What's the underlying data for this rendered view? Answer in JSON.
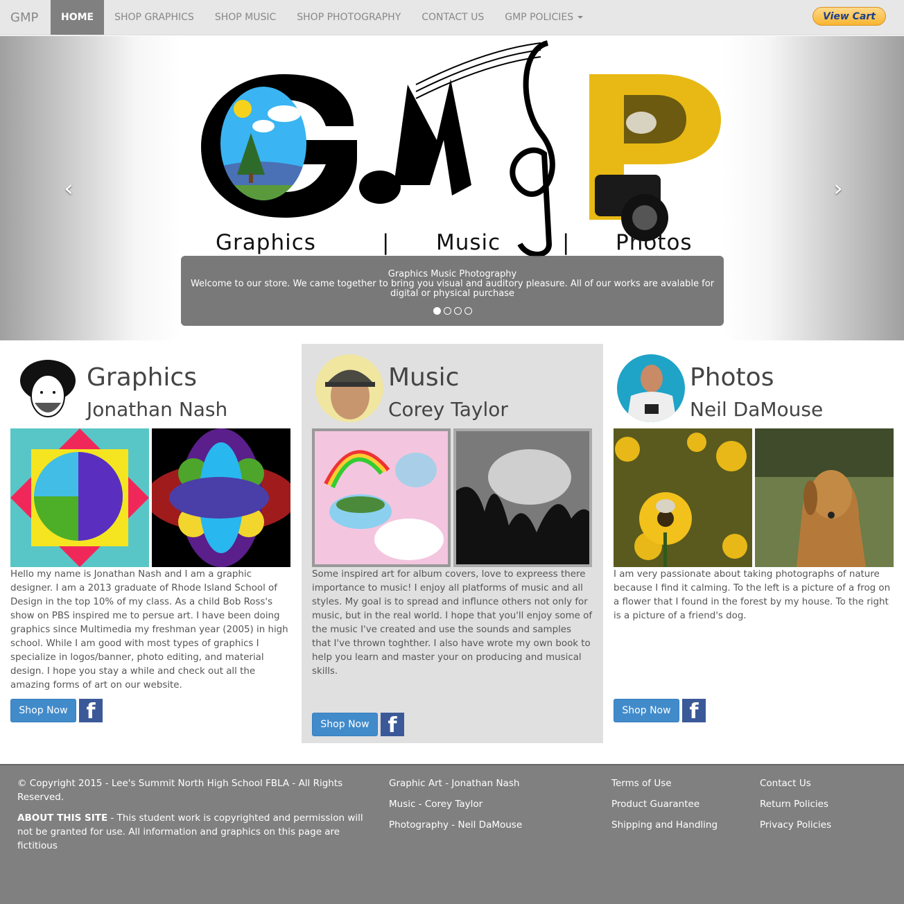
{
  "navbar": {
    "brand": "GMP",
    "items": [
      {
        "label": "HOME",
        "active": true
      },
      {
        "label": "SHOP GRAPHICS"
      },
      {
        "label": "SHOP MUSIC"
      },
      {
        "label": "SHOP PHOTOGRAPHY"
      },
      {
        "label": "CONTACT US"
      },
      {
        "label": "GMP POLICIES"
      }
    ],
    "cart_label": "View Cart"
  },
  "carousel": {
    "logo_letters": [
      "G",
      "M",
      "P"
    ],
    "tagline": [
      "Graphics",
      "|",
      "Music",
      "|",
      "Photos"
    ],
    "caption_title": "Graphics Music Photography",
    "caption_text": "Welcome to our store. We came together to bring you visual and auditory pleasure. All of our works are avalable for digital or physical purchase",
    "slide_count": 4,
    "active_slide": 1,
    "prev_icon": "chevron-left-icon",
    "next_icon": "chevron-right-icon"
  },
  "columns": [
    {
      "title": "Graphics",
      "name": "Jonathan Nash",
      "bio": "Hello my name is Jonathan Nash and I am a graphic designer. I am a 2013 graduate of Rhode Island School of Design in the top 10% of my class. As a child Bob Ross's show on PBS inspired me to persue art. I have been doing graphics since Multimedia my freshman year (2005) in high school. While I am good with most types of graphics I specialize in logos/banner, photo editing, and material design. I hope you stay a while and check out all the amazing forms of art on our website.",
      "button": "Shop Now"
    },
    {
      "title": "Music",
      "name": "Corey Taylor",
      "bio": "Some inspired art for album covers, love to expreess there importance to music! I enjoy all platforms of music and all styles. My goal is to spread and influnce others not only for music, but in the real world. I hope that you'll enjoy some of the music I've created and use the sounds and samples that I've thrown toghther. I also have wrote my own book to help you learn and master your on producing and musical skills.",
      "button": "Shop Now"
    },
    {
      "title": "Photos",
      "name": "Neil DaMouse",
      "bio": "I am very passionate about taking photographs of nature because I find it calming. To the left is a picture of a frog on a flower that I found in the forest by my house. To the right is a picture of a friend's dog.",
      "button": "Shop Now"
    }
  ],
  "footer": {
    "copyright": "© Copyright 2015 - Lee's Summit North High School FBLA - All Rights Reserved.",
    "about_label": "ABOUT THIS SITE",
    "about_text": " - This student work is copyrighted and permission will not be granted for use. All information and graphics on this page are fictitious",
    "artists": [
      "Graphic Art - Jonathan Nash",
      "Music - Corey Taylor",
      "Photography - Neil DaMouse"
    ],
    "policies": [
      "Terms of Use",
      "Product Guarantee",
      "Shipping and Handling"
    ],
    "contact": [
      "Contact Us",
      "Return Policies",
      "Privacy Policies"
    ]
  },
  "colors": {
    "nav_bg": "#e7e7e7",
    "nav_active": "#808080",
    "button_blue": "#428bca",
    "facebook_blue": "#3b5998",
    "footer_bg": "#808080",
    "music_column_bg": "#e0e0e0"
  }
}
